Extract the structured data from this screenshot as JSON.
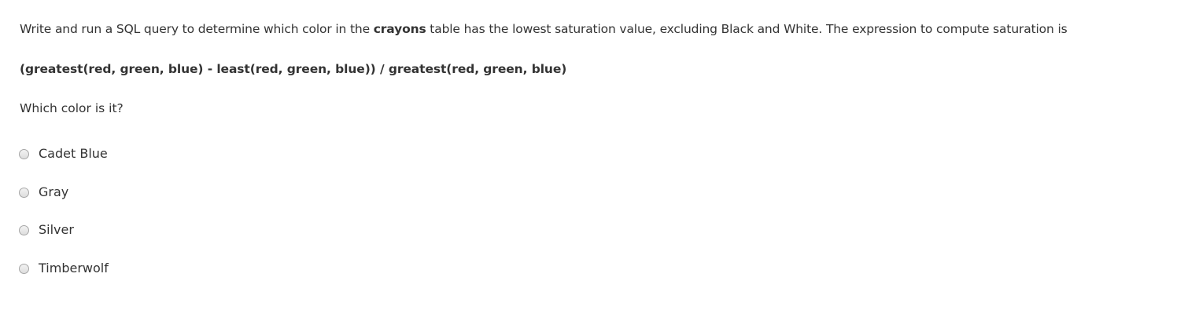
{
  "question": {
    "intro_before": "Write and run a SQL query to determine which color in the ",
    "intro_bold": "crayons",
    "intro_after": " table has the lowest saturation value, excluding Black and White. The expression to compute saturation is",
    "formula": "(greatest(red, green, blue) - least(red, green, blue)) / greatest(red, green, blue)",
    "ask": "Which color is it?"
  },
  "options": [
    {
      "label": "Cadet Blue"
    },
    {
      "label": "Gray"
    },
    {
      "label": "Silver"
    },
    {
      "label": "Timberwolf"
    }
  ]
}
